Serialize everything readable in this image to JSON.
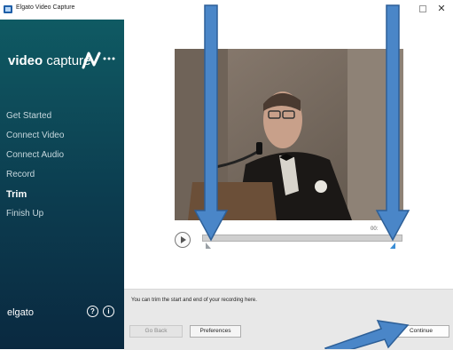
{
  "window": {
    "title": "Elgato Video Capture"
  },
  "sidebar": {
    "logo_bold": "video",
    "logo_light": "capture",
    "items": [
      {
        "label": "Get Started"
      },
      {
        "label": "Connect Video"
      },
      {
        "label": "Connect Audio"
      },
      {
        "label": "Record"
      },
      {
        "label": "Trim",
        "active": true
      },
      {
        "label": "Finish Up"
      }
    ],
    "brand": "elgato"
  },
  "player": {
    "time_text": "00:"
  },
  "footer": {
    "hint": "You can trim the start and end of your recording here.",
    "back_label": "Go Back",
    "prefs_label": "Preferences",
    "continue_label": "Continue"
  },
  "colors": {
    "sidebar_top": "#0f5a63",
    "sidebar_bottom": "#0a2940",
    "annotation_arrow": "#4a86c8",
    "handle_end": "#3b8ed6"
  },
  "icons": [
    "app-icon",
    "maximize-icon",
    "close-icon",
    "logo-wave-icon",
    "help-icon",
    "info-icon",
    "play-icon"
  ]
}
